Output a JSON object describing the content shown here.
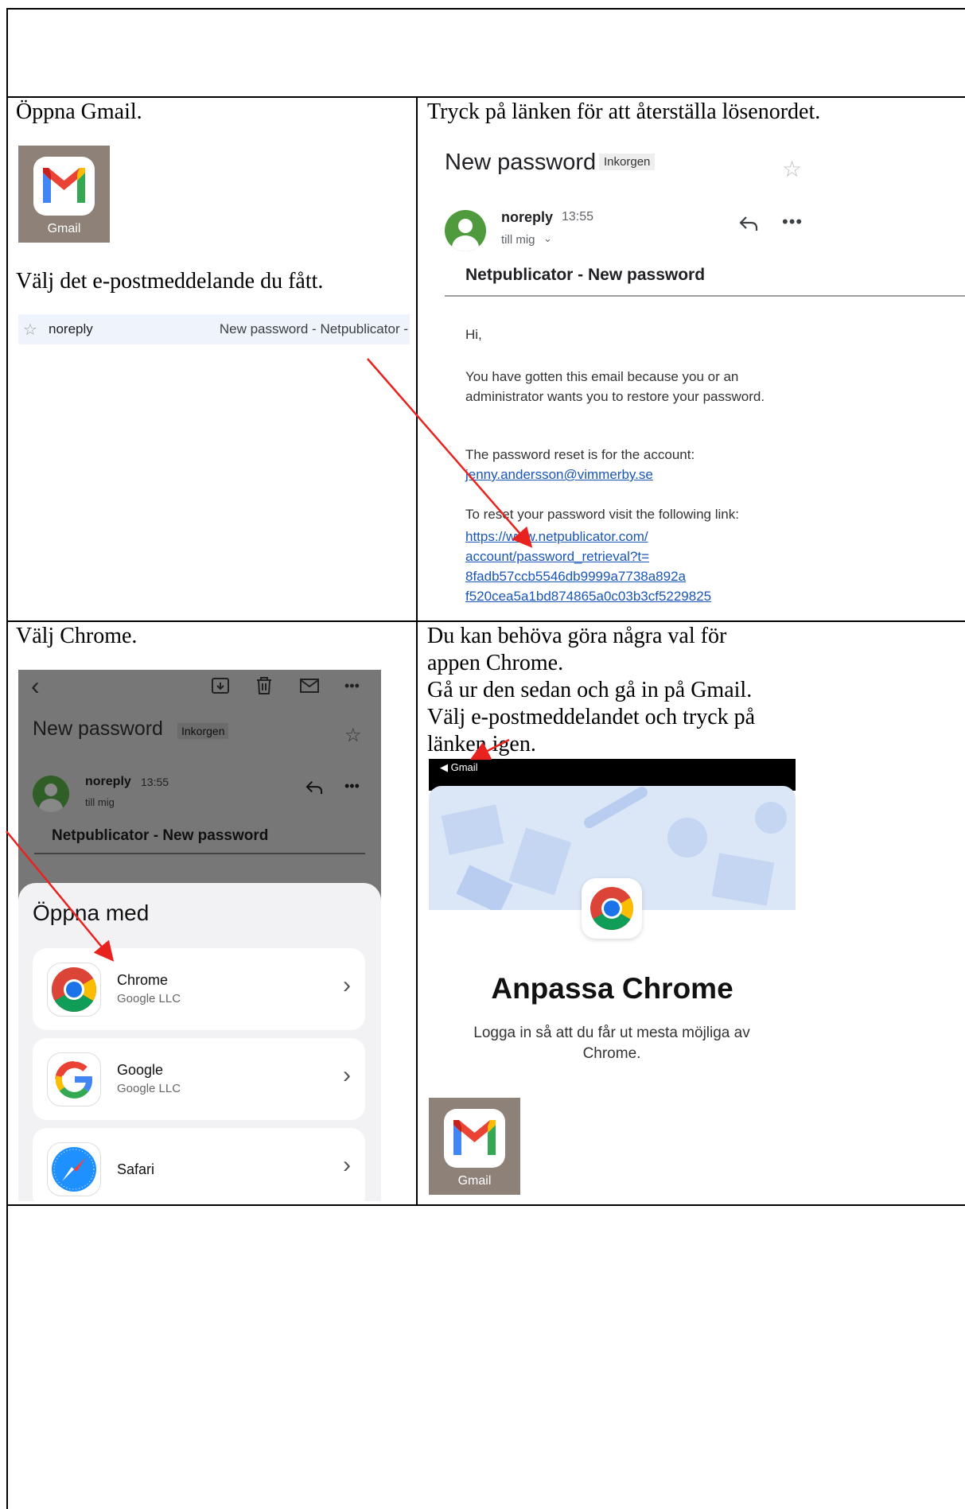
{
  "cells": {
    "step1_instruction": "Öppna Gmail.",
    "step2_instruction": "Välj det e-postmeddelande du fått.",
    "step3_instruction": "Tryck på länken för att återställa lösenordet.",
    "step4_instruction": "Välj Chrome.",
    "step5_lines": [
      "Du kan behöva göra några val för appen Chrome.",
      "Gå ur den sedan och gå in på Gmail.",
      "Välj e-postmeddelandet och tryck på länken igen."
    ]
  },
  "gmail_app": {
    "label": "Gmail"
  },
  "inbox_row": {
    "sender": "noreply",
    "preview": "New password - Netpublicator -"
  },
  "email": {
    "subject": "New password",
    "folder_badge": "Inkorgen",
    "sender": "noreply",
    "time": "13:55",
    "recipient": "till mig",
    "heading": "Netpublicator - New password",
    "greeting": "Hi,",
    "body1": "You have gotten this email because you or an administrator wants you to restore your password.",
    "body2": "The password reset is for the account:",
    "account_email": "jenny.andersson@vimmerby.se",
    "body3": "To reset your password visit the following link:",
    "reset_link_lines": [
      "https://www.netpublicator.com/",
      "account/password_retrieval?t=",
      "8fadb57ccb5546db9999a7738a892a",
      "f520cea5a1bd874865a0c03b3cf5229825"
    ]
  },
  "open_with": {
    "title": "Öppna med",
    "apps": [
      {
        "name": "Chrome",
        "vendor": "Google LLC",
        "icon": "chrome-icon"
      },
      {
        "name": "Google",
        "vendor": "Google LLC",
        "icon": "google-icon"
      },
      {
        "name": "Safari",
        "vendor": "",
        "icon": "safari-icon"
      }
    ]
  },
  "chrome_setup": {
    "back_label": "◀ Gmail",
    "title": "Anpassa Chrome",
    "subtitle": "Logga in så att du får ut mesta möjliga av Chrome."
  },
  "colors": {
    "arrow": "#e8231f",
    "link": "#1a56b8",
    "gmail_tile": "#8e8178"
  }
}
